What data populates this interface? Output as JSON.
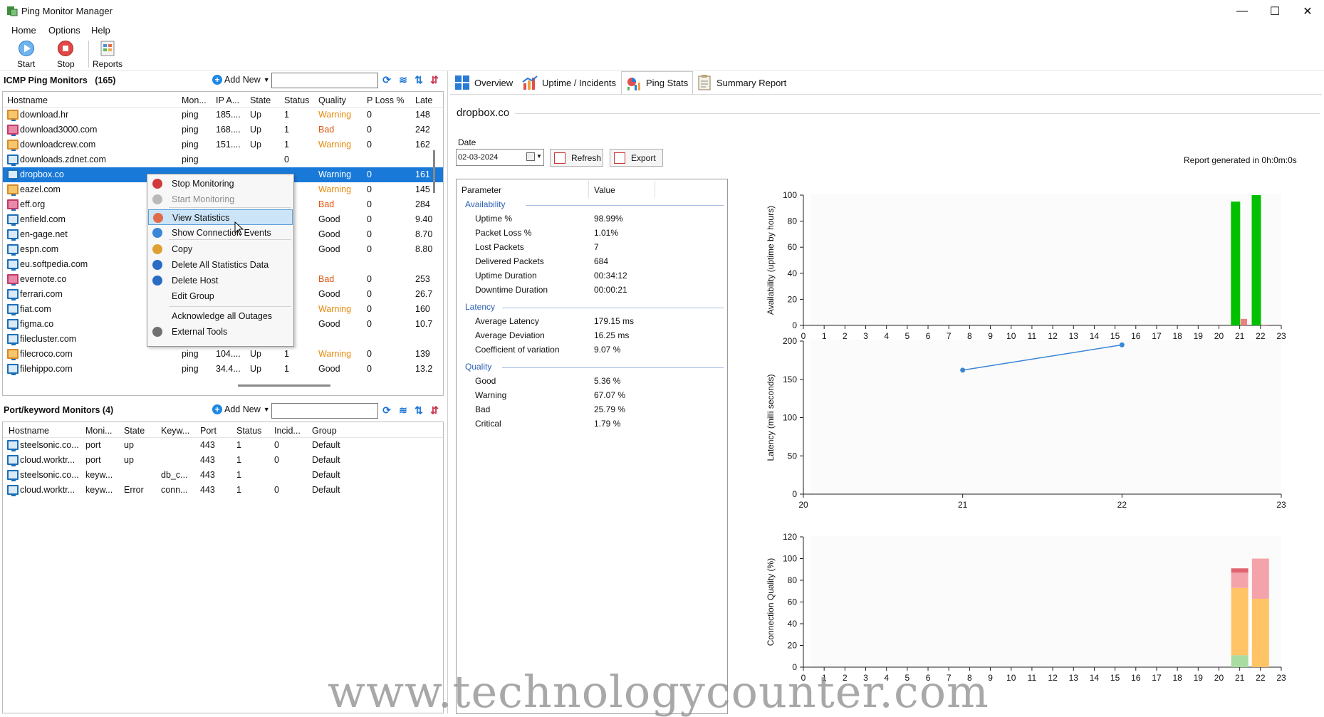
{
  "window": {
    "title": "Ping Monitor Manager",
    "minimize": "—",
    "maximize": "☐",
    "close": "✕"
  },
  "menu": [
    "Home",
    "Options",
    "Help"
  ],
  "toolbar": {
    "start": "Start",
    "stop": "Stop",
    "reports": "Reports"
  },
  "icmp": {
    "title": "ICMP Ping Monitors",
    "count": "(165)",
    "add_new": "Add New",
    "columns": [
      "Hostname",
      "Mon...",
      "IP A...",
      "State",
      "Status",
      "Quality",
      "P Loss %",
      "Late"
    ],
    "rows": [
      {
        "host": "download.hr",
        "mon": "ping",
        "ip": "185....",
        "state": "Up",
        "status": "1",
        "quality": "Warning",
        "ploss": "0",
        "lat": "148",
        "icon": "warn"
      },
      {
        "host": "download3000.com",
        "mon": "ping",
        "ip": "168....",
        "state": "Up",
        "status": "1",
        "quality": "Bad",
        "ploss": "0",
        "lat": "242",
        "icon": "bad"
      },
      {
        "host": "downloadcrew.com",
        "mon": "ping",
        "ip": "151....",
        "state": "Up",
        "status": "1",
        "quality": "Warning",
        "ploss": "0",
        "lat": "162",
        "icon": "warn"
      },
      {
        "host": "downloads.zdnet.com",
        "mon": "ping",
        "ip": "",
        "state": "",
        "status": "0",
        "quality": "",
        "ploss": "",
        "lat": "",
        "icon": "norm"
      },
      {
        "host": "dropbox.co",
        "mon": "",
        "ip": "",
        "state": "",
        "status": "",
        "quality": "Warning",
        "ploss": "0",
        "lat": "161",
        "icon": "norm"
      },
      {
        "host": "eazel.com",
        "mon": "",
        "ip": "",
        "state": "",
        "status": "",
        "quality": "Warning",
        "ploss": "0",
        "lat": "145",
        "icon": "warn"
      },
      {
        "host": "eff.org",
        "mon": "",
        "ip": "",
        "state": "",
        "status": "",
        "quality": "Bad",
        "ploss": "0",
        "lat": "284",
        "icon": "bad"
      },
      {
        "host": "enfield.com",
        "mon": "",
        "ip": "",
        "state": "",
        "status": "",
        "quality": "Good",
        "ploss": "0",
        "lat": "9.40",
        "icon": "norm"
      },
      {
        "host": "en-gage.net",
        "mon": "",
        "ip": "",
        "state": "",
        "status": "",
        "quality": "Good",
        "ploss": "0",
        "lat": "8.70",
        "icon": "norm"
      },
      {
        "host": "espn.com",
        "mon": "",
        "ip": "",
        "state": "",
        "status": "",
        "quality": "Good",
        "ploss": "0",
        "lat": "8.80",
        "icon": "norm"
      },
      {
        "host": "eu.softpedia.com",
        "mon": "",
        "ip": "",
        "state": "",
        "status": "",
        "quality": "",
        "ploss": "",
        "lat": "",
        "icon": "norm"
      },
      {
        "host": "evernote.co",
        "mon": "",
        "ip": "",
        "state": "",
        "status": "",
        "quality": "Bad",
        "ploss": "0",
        "lat": "253",
        "icon": "bad"
      },
      {
        "host": "ferrari.com",
        "mon": "",
        "ip": "",
        "state": "",
        "status": "",
        "quality": "Good",
        "ploss": "0",
        "lat": "26.7",
        "icon": "norm"
      },
      {
        "host": "fiat.com",
        "mon": "",
        "ip": "",
        "state": "",
        "status": "",
        "quality": "Warning",
        "ploss": "0",
        "lat": "160",
        "icon": "norm"
      },
      {
        "host": "figma.co",
        "mon": "",
        "ip": "",
        "state": "",
        "status": "",
        "quality": "Good",
        "ploss": "0",
        "lat": "10.7",
        "icon": "norm"
      },
      {
        "host": "filecluster.com",
        "mon": "",
        "ip": "",
        "state": "",
        "status": "",
        "quality": "",
        "ploss": "",
        "lat": "",
        "icon": "norm"
      },
      {
        "host": "filecroco.com",
        "mon": "ping",
        "ip": "104....",
        "state": "Up",
        "status": "1",
        "quality": "Warning",
        "ploss": "0",
        "lat": "139",
        "icon": "warn"
      },
      {
        "host": "filehippo.com",
        "mon": "ping",
        "ip": "34.4...",
        "state": "Up",
        "status": "1",
        "quality": "Good",
        "ploss": "0",
        "lat": "13.2",
        "icon": "norm"
      }
    ]
  },
  "context_menu": [
    {
      "label": "Stop Monitoring",
      "icon": "stop-icon"
    },
    {
      "label": "Start Monitoring",
      "icon": "start-icon"
    },
    {
      "label": "View Statistics",
      "icon": "statistics-icon"
    },
    {
      "label": "Show Connection Events",
      "icon": "events-icon"
    },
    {
      "label": "Copy",
      "icon": "copy-icon"
    },
    {
      "label": "Delete All Statistics Data",
      "icon": "delete-data-icon"
    },
    {
      "label": "Delete Host",
      "icon": "delete-host-icon"
    },
    {
      "label": "Edit Group",
      "icon": ""
    },
    {
      "label": "Acknowledge all Outages",
      "icon": ""
    },
    {
      "label": "External Tools",
      "icon": "tools-icon"
    }
  ],
  "port": {
    "title": "Port/keyword Monitors (4)",
    "add_new": "Add New",
    "columns": [
      "Hostname",
      "Moni...",
      "State",
      "Keyw...",
      "Port",
      "Status",
      "Incid...",
      "Group"
    ],
    "rows": [
      {
        "host": "steelsonic.co...",
        "mon": "port",
        "state": "up",
        "kw": "",
        "port": "443",
        "status": "1",
        "inc": "0",
        "group": "Default"
      },
      {
        "host": "cloud.worktr...",
        "mon": "port",
        "state": "up",
        "kw": "",
        "port": "443",
        "status": "1",
        "inc": "0",
        "group": "Default"
      },
      {
        "host": "steelsonic.co...",
        "mon": "keyw...",
        "state": "",
        "kw": "db_c...",
        "port": "443",
        "status": "1",
        "inc": "",
        "group": "Default"
      },
      {
        "host": "cloud.worktr...",
        "mon": "keyw...",
        "state": "Error",
        "kw": "conn...",
        "port": "443",
        "status": "1",
        "inc": "0",
        "group": "Default"
      }
    ]
  },
  "tabs": [
    "Overview",
    "Uptime / Incidents",
    "Ping Stats",
    "Summary Report"
  ],
  "report": {
    "host": "dropbox.co",
    "date_label": "Date",
    "date_value": "02-03-2024",
    "refresh": "Refresh",
    "export": "Export",
    "generated": "Report generated in 0h:0m:0s"
  },
  "stats": {
    "col_param": "Parameter",
    "col_value": "Value",
    "groups": [
      {
        "name": "Availability",
        "items": [
          {
            "k": "Uptime %",
            "v": "98.99%"
          },
          {
            "k": "Packet Loss %",
            "v": "1.01%"
          },
          {
            "k": "Lost Packets",
            "v": "7"
          },
          {
            "k": "Delivered Packets",
            "v": "684"
          },
          {
            "k": "Uptime Duration",
            "v": "00:34:12"
          },
          {
            "k": "Downtime Duration",
            "v": "00:00:21"
          }
        ]
      },
      {
        "name": "Latency",
        "items": [
          {
            "k": "Average Latency",
            "v": "179.15 ms"
          },
          {
            "k": "Average Deviation",
            "v": "16.25 ms"
          },
          {
            "k": "Coefficient of variation",
            "v": "9.07 %"
          }
        ]
      },
      {
        "name": "Quality",
        "items": [
          {
            "k": "Good",
            "v": "5.36 %"
          },
          {
            "k": "Warning",
            "v": "67.07 %"
          },
          {
            "k": "Bad",
            "v": "25.79 %"
          },
          {
            "k": "Critical",
            "v": "1.79 %"
          }
        ]
      }
    ]
  },
  "chart_data": [
    {
      "type": "bar",
      "ylabel": "Availability (uptime by hours)",
      "ylim": [
        0,
        100
      ],
      "yticks": [
        0,
        20,
        40,
        60,
        80,
        100
      ],
      "categories": [
        0,
        1,
        2,
        3,
        4,
        5,
        6,
        7,
        8,
        9,
        10,
        11,
        12,
        13,
        14,
        15,
        16,
        17,
        18,
        19,
        20,
        21,
        22,
        23
      ],
      "series": [
        {
          "color": "#00c000",
          "points": [
            {
              "x": 20.8,
              "y": 95
            },
            {
              "x": 21.8,
              "y": 100
            }
          ]
        },
        {
          "color": "#f08080",
          "points": [
            {
              "x": 21.2,
              "y": 5
            },
            {
              "x": 22.2,
              "y": 0.5
            }
          ]
        }
      ]
    },
    {
      "type": "line",
      "ylabel": "Latency (milli seconds)",
      "xlim": [
        20,
        23
      ],
      "ylim": [
        0,
        200
      ],
      "xticks": [
        20,
        21,
        22,
        23
      ],
      "yticks": [
        0,
        50,
        100,
        150,
        200
      ],
      "series": [
        {
          "color": "#3a86d8",
          "x": [
            21,
            22
          ],
          "y": [
            162,
            195
          ]
        }
      ]
    },
    {
      "type": "bar",
      "stacked": true,
      "ylabel": "Connection Quality (%)",
      "ylim": [
        0,
        120
      ],
      "yticks": [
        0,
        20,
        40,
        60,
        80,
        100,
        120
      ],
      "categories": [
        0,
        1,
        2,
        3,
        4,
        5,
        6,
        7,
        8,
        9,
        10,
        11,
        12,
        13,
        14,
        15,
        16,
        17,
        18,
        19,
        20,
        21,
        22,
        23
      ],
      "stack_colors": {
        "good": "#a8dca0",
        "warning": "#ffc466",
        "bad": "#f5a3aa",
        "critical": "#e06470"
      },
      "stacks": [
        {
          "x": 21,
          "good": 11,
          "warning": 62,
          "bad": 14,
          "critical": 4
        },
        {
          "x": 22,
          "good": 0,
          "warning": 63,
          "bad": 37,
          "critical": 0
        }
      ]
    }
  ],
  "watermark": "www.technologycounter.com"
}
